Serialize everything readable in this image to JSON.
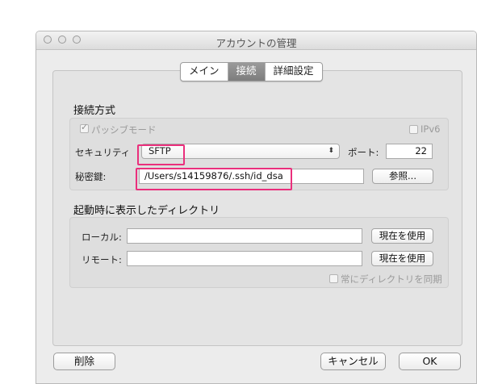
{
  "window": {
    "title": "アカウントの管理"
  },
  "tabs": [
    {
      "label": "メイン",
      "active": false
    },
    {
      "label": "接続",
      "active": true
    },
    {
      "label": "詳細設定",
      "active": false
    }
  ],
  "connection": {
    "section_title": "接続方式",
    "passive_label": "パッシブモード",
    "passive_checked": true,
    "ipv6_label": "IPv6",
    "ipv6_checked": false,
    "security_label": "セキュリティ",
    "security_value": "SFTP",
    "port_label": "ポート:",
    "port_value": "22",
    "key_label": "秘密鍵:",
    "key_value": "/Users/s14159876/.ssh/id_dsa",
    "browse_label": "参照..."
  },
  "startup": {
    "section_title": "起動時に表示したディレクトリ",
    "local_label": "ローカル:",
    "local_value": "",
    "remote_label": "リモート:",
    "remote_value": "",
    "use_current_label": "現在を使用",
    "sync_label": "常にディレクトリを同期",
    "sync_checked": false
  },
  "footer": {
    "delete_label": "削除",
    "cancel_label": "キャンセル",
    "ok_label": "OK"
  },
  "colors": {
    "highlight": "#ea2f7c",
    "tab_active": "#8a8a8a"
  }
}
